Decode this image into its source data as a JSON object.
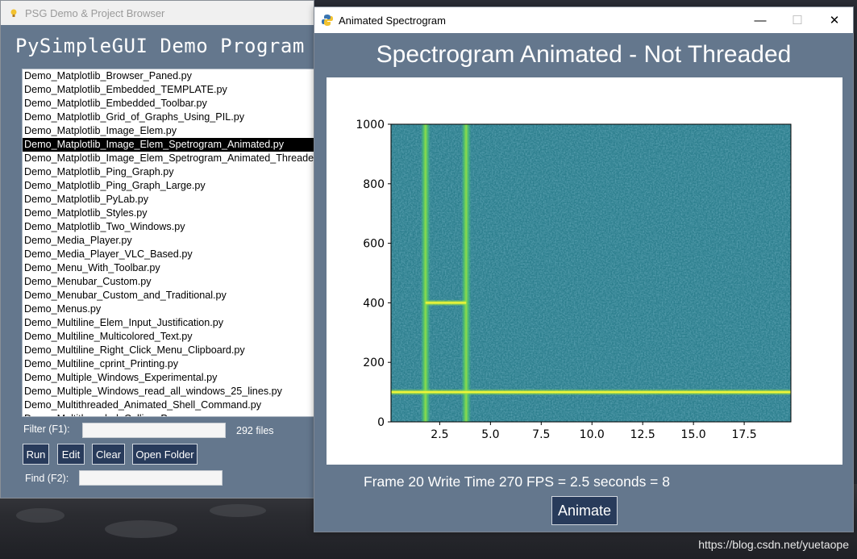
{
  "left_window": {
    "title": "PSG Demo & Project Browser",
    "heading": "PySimpleGUI Demo Program &",
    "files": [
      "Demo_Matplotlib_Browser_Paned.py",
      "Demo_Matplotlib_Embedded_TEMPLATE.py",
      "Demo_Matplotlib_Embedded_Toolbar.py",
      "Demo_Matplotlib_Grid_of_Graphs_Using_PIL.py",
      "Demo_Matplotlib_Image_Elem.py",
      "Demo_Matplotlib_Image_Elem_Spetrogram_Animated.py",
      "Demo_Matplotlib_Image_Elem_Spetrogram_Animated_Threaded.py",
      "Demo_Matplotlib_Ping_Graph.py",
      "Demo_Matplotlib_Ping_Graph_Large.py",
      "Demo_Matplotlib_PyLab.py",
      "Demo_Matplotlib_Styles.py",
      "Demo_Matplotlib_Two_Windows.py",
      "Demo_Media_Player.py",
      "Demo_Media_Player_VLC_Based.py",
      "Demo_Menu_With_Toolbar.py",
      "Demo_Menubar_Custom.py",
      "Demo_Menubar_Custom_and_Traditional.py",
      "Demo_Menus.py",
      "Demo_Multiline_Elem_Input_Justification.py",
      "Demo_Multiline_Multicolored_Text.py",
      "Demo_Multiline_Right_Click_Menu_Clipboard.py",
      "Demo_Multiline_cprint_Printing.py",
      "Demo_Multiple_Windows_Experimental.py",
      "Demo_Multiple_Windows_read_all_windows_25_lines.py",
      "Demo_Multithreaded_Animated_Shell_Command.py",
      "Demo_Multithreaded_Calling_Popup.py"
    ],
    "selected_index": 5,
    "filter_label": "Filter (F1):",
    "filter_value": "",
    "file_count": "292 files",
    "buttons": {
      "run": "Run",
      "edit": "Edit",
      "clear": "Clear",
      "open_folder": "Open Folder"
    },
    "find_label": "Find (F2):",
    "find_value": ""
  },
  "right_window": {
    "title": "Animated Spectrogram",
    "heading": "Spectrogram Animated - Not Threaded",
    "status": "Frame 20 Write Time 270 FPS = 2.5 seconds = 8",
    "animate_button": "Animate",
    "window_controls": {
      "minimize": "—",
      "maximize": "☐",
      "close": "✕"
    }
  },
  "chart_data": {
    "type": "heatmap",
    "xlim": [
      0.1,
      19.8
    ],
    "ylim": [
      0,
      1000
    ],
    "xticks": [
      2.5,
      5.0,
      7.5,
      10.0,
      12.5,
      15.0,
      17.5
    ],
    "xtick_labels": [
      "2.5",
      "5.0",
      "7.5",
      "10.0",
      "12.5",
      "15.0",
      "17.5"
    ],
    "yticks": [
      0,
      200,
      400,
      600,
      800,
      1000
    ],
    "ytick_labels": [
      "0",
      "200",
      "400",
      "600",
      "800",
      "1000"
    ],
    "background_color": "#2d7f8e",
    "highlight_color": "#f0f53a",
    "features": [
      {
        "kind": "vertical",
        "x": 1.8
      },
      {
        "kind": "vertical",
        "x": 3.8
      },
      {
        "kind": "horizontal",
        "y": 400,
        "x_start": 1.8,
        "x_end": 3.8
      },
      {
        "kind": "horizontal",
        "y": 100,
        "x_start": 0.1,
        "x_end": 19.8
      }
    ]
  },
  "watermark": "https://blog.csdn.net/yuetaope"
}
